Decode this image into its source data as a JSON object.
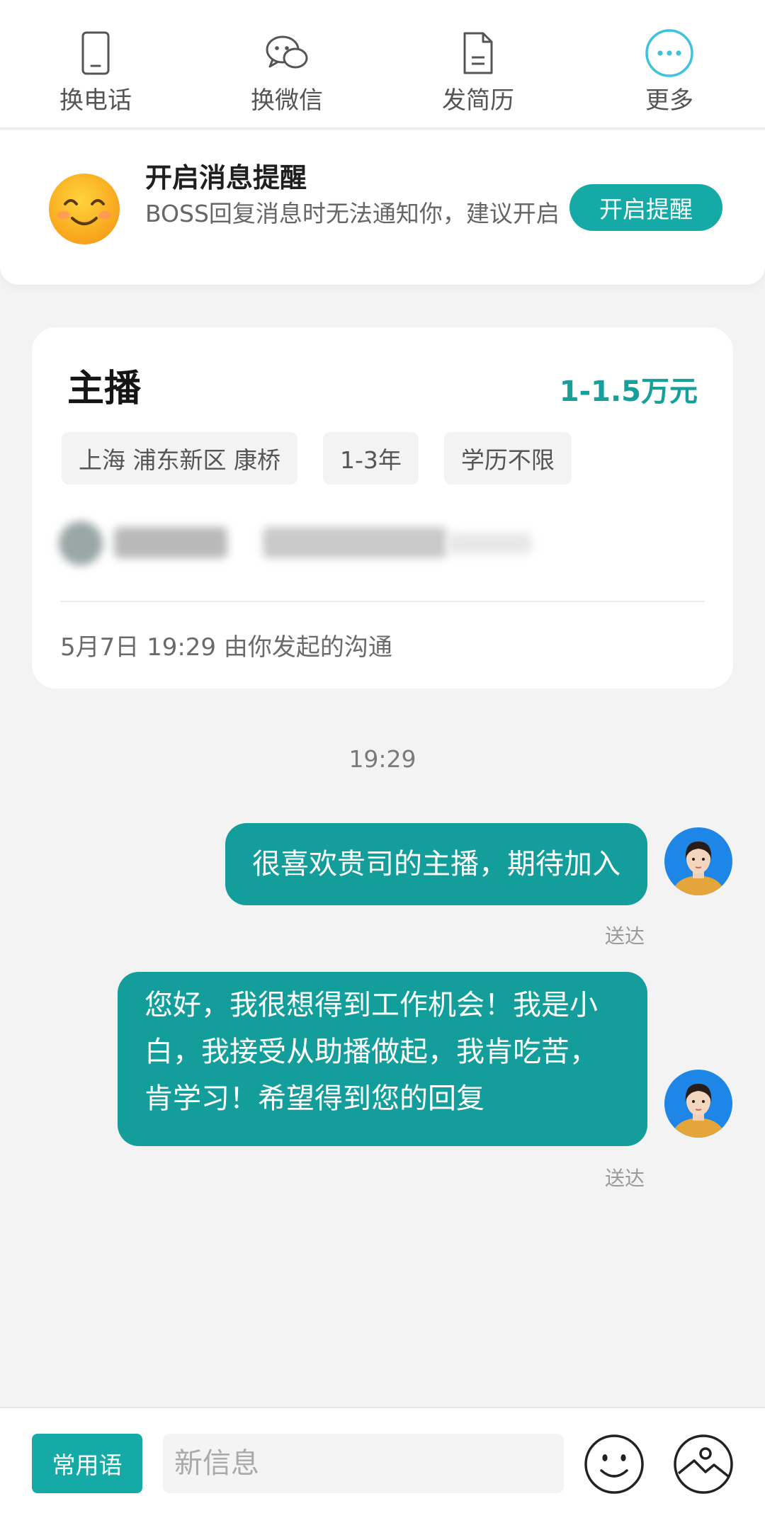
{
  "top_actions": [
    {
      "label": "换电话",
      "icon": "phone-icon"
    },
    {
      "label": "换微信",
      "icon": "wechat-icon"
    },
    {
      "label": "发简历",
      "icon": "resume-icon"
    },
    {
      "label": "更多",
      "icon": "more-icon"
    }
  ],
  "notification": {
    "title": "开启消息提醒",
    "description": "BOSS回复消息时无法通知你，建议开启",
    "button": "开启提醒",
    "icon": "smiley-icon"
  },
  "job": {
    "title": "主播",
    "salary": "1-1.5万元",
    "tags": [
      "上海 浦东新区 康桥",
      "1-3年",
      "学历不限"
    ],
    "initiated": "5月7日 19:29 由你发起的沟通"
  },
  "chat": {
    "timestamp": "19:29",
    "messages": [
      {
        "text": "很喜欢贵司的主播，期待加入",
        "status": "送达"
      },
      {
        "text": "您好，我很想得到工作机会！我是小白，我接受从助播做起，我肯吃苦，肯学习！希望得到您的回复",
        "status": "送达"
      }
    ]
  },
  "input_bar": {
    "phrase_button": "常用语",
    "placeholder": "新信息",
    "emoji_icon": "emoji-icon",
    "image_icon": "image-icon"
  },
  "colors": {
    "accent": "#16aaa6",
    "bubble": "#139e9b",
    "salary": "#15a09c",
    "more_icon": "#3ec3dc"
  }
}
